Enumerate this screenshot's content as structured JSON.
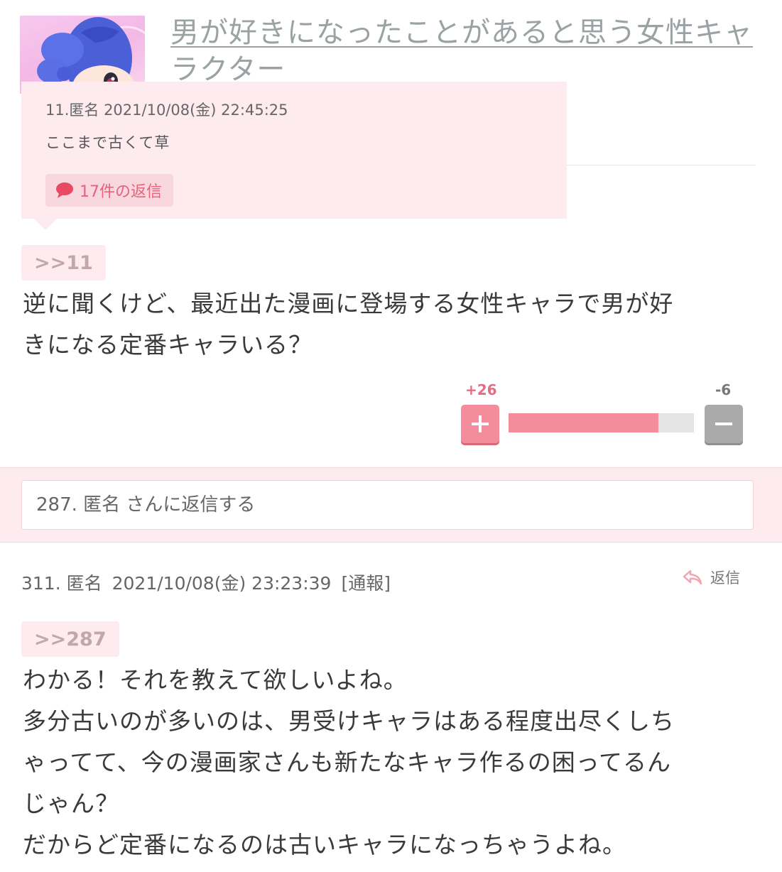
{
  "header": {
    "title": "男が好きになったことがあると思う女性キャラクター"
  },
  "popup": {
    "meta": "11.匿名 2021/10/08(金) 22:45:25",
    "body": "ここまで古くて草",
    "reply_count": "17件の返信"
  },
  "post1": {
    "anchor": ">>11",
    "lines": [
      "逆に聞くけど、最近出た漫画に登場する女性キャラで男が好",
      "きになる定番キャラいる？"
    ],
    "votes": {
      "plus": "+26",
      "minus": "-6",
      "plus_ratio": 0.81
    }
  },
  "reply_box": {
    "placeholder": "287. 匿名 さんに返信する"
  },
  "post2": {
    "number_author": "311. 匿名",
    "datetime": "2021/10/08(金) 23:23:39",
    "report": "[通報]",
    "reply_label": "返信",
    "anchor": ">>287",
    "lines": [
      "わかる！それを教えて欲しいよね。",
      "多分古いのが多いのは、男受けキャラはある程度出尽くしち",
      "ゃってて、今の漫画家さんも新たなキャラ作るの困ってるん",
      "じゃん？",
      "だからど定番になるのは古いキャラになっちゃうよね。"
    ]
  },
  "colors": {
    "accent_pink": "#f58c9c",
    "pink_bg": "#fdebef",
    "minus_gray": "#aaaaaa"
  },
  "icons": [
    "speech-bubble-icon",
    "plus-icon",
    "minus-icon",
    "reply-arrow-icon"
  ]
}
